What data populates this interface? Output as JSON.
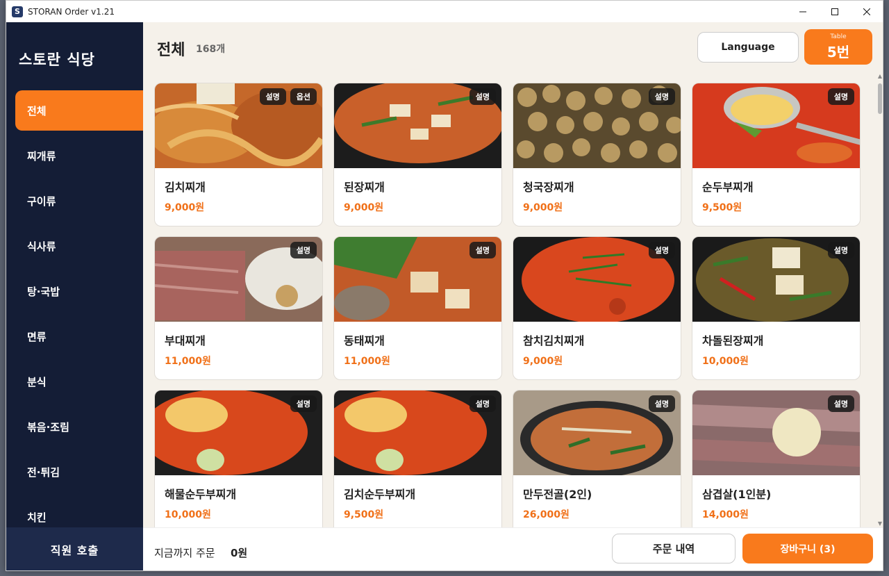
{
  "window": {
    "title": "STORAN Order  v1.21",
    "app_icon_letter": "S"
  },
  "sidebar": {
    "store_name": "스토란 식당",
    "categories": [
      {
        "label": "전체",
        "active": true
      },
      {
        "label": "찌개류"
      },
      {
        "label": "구이류"
      },
      {
        "label": "식사류"
      },
      {
        "label": "탕·국밥"
      },
      {
        "label": "면류"
      },
      {
        "label": "분식"
      },
      {
        "label": "볶음·조림"
      },
      {
        "label": "전·튀김"
      },
      {
        "label": "치킨"
      }
    ],
    "staff_call_label": "직원 호출"
  },
  "header": {
    "title": "전체",
    "count": "168개",
    "language_label": "Language",
    "table_label": "Table",
    "table_number": "5번"
  },
  "menu": [
    {
      "name": "김치찌개",
      "price": "9,000원",
      "badges": [
        "설명",
        "옵션"
      ]
    },
    {
      "name": "된장찌개",
      "price": "9,000원",
      "badges": [
        "설명"
      ]
    },
    {
      "name": "청국장찌개",
      "price": "9,000원",
      "badges": [
        "설명"
      ]
    },
    {
      "name": "순두부찌개",
      "price": "9,500원",
      "badges": [
        "설명"
      ]
    },
    {
      "name": "부대찌개",
      "price": "11,000원",
      "badges": [
        "설명"
      ]
    },
    {
      "name": "동태찌개",
      "price": "11,000원",
      "badges": [
        "설명"
      ]
    },
    {
      "name": "참치김치찌개",
      "price": "9,000원",
      "badges": [
        "설명"
      ]
    },
    {
      "name": "차돌된장찌개",
      "price": "10,000원",
      "badges": [
        "설명"
      ]
    },
    {
      "name": "해물순두부찌개",
      "price": "10,000원",
      "badges": [
        "설명"
      ]
    },
    {
      "name": "김치순두부찌개",
      "price": "9,500원",
      "badges": [
        "설명"
      ]
    },
    {
      "name": "만두전골(2인)",
      "price": "26,000원",
      "badges": [
        "설명"
      ]
    },
    {
      "name": "삼겹살(1인분)",
      "price": "14,000원",
      "badges": [
        "설명"
      ]
    }
  ],
  "footer": {
    "total_label": "지금까지 주문",
    "total_value": "0원",
    "history_label": "주문 내역",
    "cart_label": "장바구니 (3)"
  },
  "colors": {
    "accent": "#f97a1c",
    "sidebar": "#141d36",
    "price": "#f07018",
    "background": "#f5f1ea"
  }
}
